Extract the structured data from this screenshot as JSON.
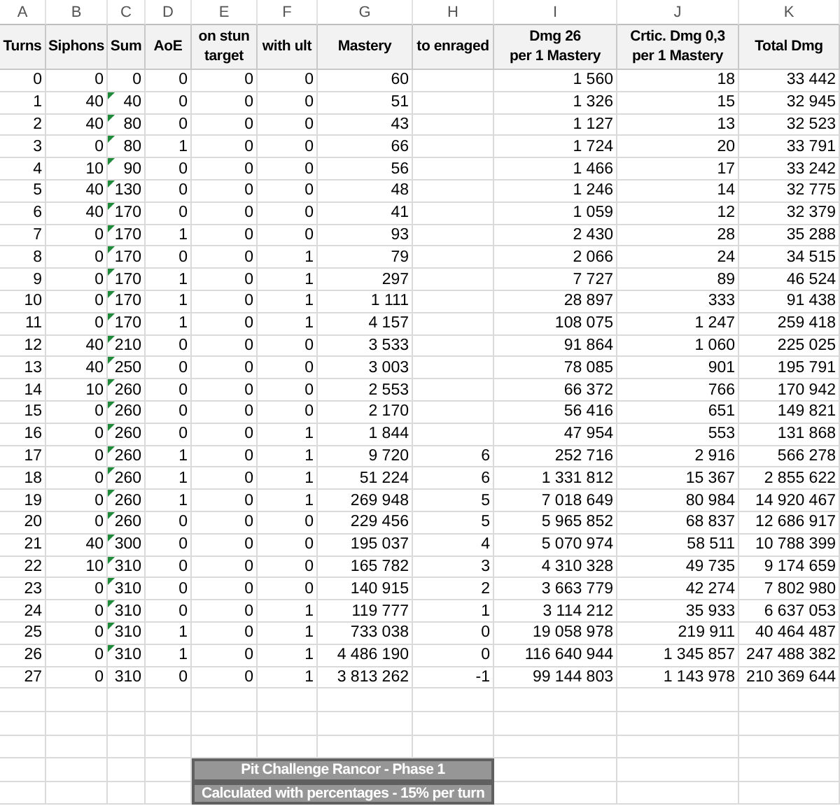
{
  "column_letters": [
    "A",
    "B",
    "C",
    "D",
    "E",
    "F",
    "G",
    "H",
    "I",
    "J",
    "K"
  ],
  "headings": [
    "Turns",
    "Siphons",
    "Sum",
    "AoE",
    "on stun\ntarget",
    "with ult",
    "Mastery",
    "to enraged",
    "Dmg 26\nper 1 Mastery",
    "Crtic. Dmg 0,3\nper 1 Mastery",
    "Total Dmg"
  ],
  "rows": [
    {
      "turns": "0",
      "siphons": "0",
      "sum": "0",
      "sum_flagged": false,
      "aoe": "0",
      "on_stun_target": "0",
      "with_ult": "0",
      "mastery": "60",
      "dmg": "1 560",
      "crit_dmg": "18",
      "total_dmg": "33 442"
    },
    {
      "turns": "1",
      "siphons": "40",
      "sum": "40",
      "sum_flagged": true,
      "aoe": "0",
      "on_stun_target": "0",
      "with_ult": "0",
      "mastery": "51",
      "dmg": "1 326",
      "crit_dmg": "15",
      "total_dmg": "32 945"
    },
    {
      "turns": "2",
      "siphons": "40",
      "sum": "80",
      "sum_flagged": true,
      "aoe": "0",
      "on_stun_target": "0",
      "with_ult": "0",
      "mastery": "43",
      "dmg": "1 127",
      "crit_dmg": "13",
      "total_dmg": "32 523"
    },
    {
      "turns": "3",
      "siphons": "0",
      "sum": "80",
      "sum_flagged": true,
      "aoe": "1",
      "on_stun_target": "0",
      "with_ult": "0",
      "mastery": "66",
      "dmg": "1 724",
      "crit_dmg": "20",
      "total_dmg": "33 791"
    },
    {
      "turns": "4",
      "siphons": "10",
      "sum": "90",
      "sum_flagged": true,
      "aoe": "0",
      "on_stun_target": "0",
      "with_ult": "0",
      "mastery": "56",
      "dmg": "1 466",
      "crit_dmg": "17",
      "total_dmg": "33 242"
    },
    {
      "turns": "5",
      "siphons": "40",
      "sum": "130",
      "sum_flagged": true,
      "aoe": "0",
      "on_stun_target": "0",
      "with_ult": "0",
      "mastery": "48",
      "dmg": "1 246",
      "crit_dmg": "14",
      "total_dmg": "32 775"
    },
    {
      "turns": "6",
      "siphons": "40",
      "sum": "170",
      "sum_flagged": true,
      "aoe": "0",
      "on_stun_target": "0",
      "with_ult": "0",
      "mastery": "41",
      "dmg": "1 059",
      "crit_dmg": "12",
      "total_dmg": "32 379"
    },
    {
      "turns": "7",
      "siphons": "0",
      "sum": "170",
      "sum_flagged": true,
      "aoe": "1",
      "on_stun_target": "0",
      "with_ult": "0",
      "mastery": "93",
      "dmg": "2 430",
      "crit_dmg": "28",
      "total_dmg": "35 288"
    },
    {
      "turns": "8",
      "siphons": "0",
      "sum": "170",
      "sum_flagged": true,
      "aoe": "0",
      "on_stun_target": "0",
      "with_ult": "1",
      "mastery": "79",
      "dmg": "2 066",
      "crit_dmg": "24",
      "total_dmg": "34 515"
    },
    {
      "turns": "9",
      "siphons": "0",
      "sum": "170",
      "sum_flagged": true,
      "aoe": "1",
      "on_stun_target": "0",
      "with_ult": "1",
      "mastery": "297",
      "dmg": "7 727",
      "crit_dmg": "89",
      "total_dmg": "46 524"
    },
    {
      "turns": "10",
      "siphons": "0",
      "sum": "170",
      "sum_flagged": true,
      "aoe": "1",
      "on_stun_target": "0",
      "with_ult": "1",
      "mastery": "1 111",
      "dmg": "28 897",
      "crit_dmg": "333",
      "total_dmg": "91 438"
    },
    {
      "turns": "11",
      "siphons": "0",
      "sum": "170",
      "sum_flagged": true,
      "aoe": "1",
      "on_stun_target": "0",
      "with_ult": "1",
      "mastery": "4 157",
      "dmg": "108 075",
      "crit_dmg": "1 247",
      "total_dmg": "259 418"
    },
    {
      "turns": "12",
      "siphons": "40",
      "sum": "210",
      "sum_flagged": true,
      "aoe": "0",
      "on_stun_target": "0",
      "with_ult": "0",
      "mastery": "3 533",
      "dmg": "91 864",
      "crit_dmg": "1 060",
      "total_dmg": "225 025"
    },
    {
      "turns": "13",
      "siphons": "40",
      "sum": "250",
      "sum_flagged": true,
      "aoe": "0",
      "on_stun_target": "0",
      "with_ult": "0",
      "mastery": "3 003",
      "dmg": "78 085",
      "crit_dmg": "901",
      "total_dmg": "195 791"
    },
    {
      "turns": "14",
      "siphons": "10",
      "sum": "260",
      "sum_flagged": true,
      "aoe": "0",
      "on_stun_target": "0",
      "with_ult": "0",
      "mastery": "2 553",
      "dmg": "66 372",
      "crit_dmg": "766",
      "total_dmg": "170 942"
    },
    {
      "turns": "15",
      "siphons": "0",
      "sum": "260",
      "sum_flagged": true,
      "aoe": "0",
      "on_stun_target": "0",
      "with_ult": "0",
      "mastery": "2 170",
      "dmg": "56 416",
      "crit_dmg": "651",
      "total_dmg": "149 821"
    },
    {
      "turns": "16",
      "siphons": "0",
      "sum": "260",
      "sum_flagged": true,
      "aoe": "0",
      "on_stun_target": "0",
      "with_ult": "1",
      "mastery": "1 844",
      "dmg": "47 954",
      "crit_dmg": "553",
      "total_dmg": "131 868"
    },
    {
      "turns": "17",
      "siphons": "0",
      "sum": "260",
      "sum_flagged": true,
      "aoe": "1",
      "on_stun_target": "0",
      "with_ult": "1",
      "mastery": "9 720",
      "to_enraged": "6",
      "dmg": "252 716",
      "crit_dmg": "2 916",
      "total_dmg": "566 278"
    },
    {
      "turns": "18",
      "siphons": "0",
      "sum": "260",
      "sum_flagged": true,
      "aoe": "1",
      "on_stun_target": "0",
      "with_ult": "1",
      "mastery": "51 224",
      "to_enraged": "6",
      "dmg": "1 331 812",
      "crit_dmg": "15 367",
      "total_dmg": "2 855 622"
    },
    {
      "turns": "19",
      "siphons": "0",
      "sum": "260",
      "sum_flagged": true,
      "aoe": "1",
      "on_stun_target": "0",
      "with_ult": "1",
      "mastery": "269 948",
      "to_enraged": "5",
      "dmg": "7 018 649",
      "crit_dmg": "80 984",
      "total_dmg": "14 920 467"
    },
    {
      "turns": "20",
      "siphons": "0",
      "sum": "260",
      "sum_flagged": true,
      "aoe": "0",
      "on_stun_target": "0",
      "with_ult": "0",
      "mastery": "229 456",
      "to_enraged": "5",
      "dmg": "5 965 852",
      "crit_dmg": "68 837",
      "total_dmg": "12 686 917"
    },
    {
      "turns": "21",
      "siphons": "40",
      "sum": "300",
      "sum_flagged": true,
      "aoe": "0",
      "on_stun_target": "0",
      "with_ult": "0",
      "mastery": "195 037",
      "to_enraged": "4",
      "dmg": "5 070 974",
      "crit_dmg": "58 511",
      "total_dmg": "10 788 399"
    },
    {
      "turns": "22",
      "siphons": "10",
      "sum": "310",
      "sum_flagged": true,
      "aoe": "0",
      "on_stun_target": "0",
      "with_ult": "0",
      "mastery": "165 782",
      "to_enraged": "3",
      "dmg": "4 310 328",
      "crit_dmg": "49 735",
      "total_dmg": "9 174 659"
    },
    {
      "turns": "23",
      "siphons": "0",
      "sum": "310",
      "sum_flagged": true,
      "aoe": "0",
      "on_stun_target": "0",
      "with_ult": "0",
      "mastery": "140 915",
      "to_enraged": "2",
      "dmg": "3 663 779",
      "crit_dmg": "42 274",
      "total_dmg": "7 802 980"
    },
    {
      "turns": "24",
      "siphons": "0",
      "sum": "310",
      "sum_flagged": true,
      "aoe": "0",
      "on_stun_target": "0",
      "with_ult": "1",
      "mastery": "119 777",
      "to_enraged": "1",
      "dmg": "3 114 212",
      "crit_dmg": "35 933",
      "total_dmg": "6 637 053"
    },
    {
      "turns": "25",
      "siphons": "0",
      "sum": "310",
      "sum_flagged": true,
      "aoe": "1",
      "on_stun_target": "0",
      "with_ult": "1",
      "mastery": "733 038",
      "to_enraged": "0",
      "dmg": "19 058 978",
      "crit_dmg": "219 911",
      "total_dmg": "40 464 487"
    },
    {
      "turns": "26",
      "siphons": "0",
      "sum": "310",
      "sum_flagged": true,
      "aoe": "1",
      "on_stun_target": "0",
      "with_ult": "1",
      "mastery": "4 486 190",
      "to_enraged": "0",
      "dmg": "116 640 944",
      "crit_dmg": "1 345 857",
      "total_dmg": "247 488 382"
    },
    {
      "turns": "27",
      "siphons": "0",
      "sum": "310",
      "sum_flagged": false,
      "aoe": "0",
      "on_stun_target": "0",
      "with_ult": "1",
      "mastery": "3 813 262",
      "to_enraged": "-1",
      "dmg": "99 144 803",
      "crit_dmg": "1 143 978",
      "total_dmg": "210 369 644"
    }
  ],
  "banner": [
    "Pit Challenge Rancor - Phase 1",
    "Calculated with percentages - 15% per turn"
  ]
}
